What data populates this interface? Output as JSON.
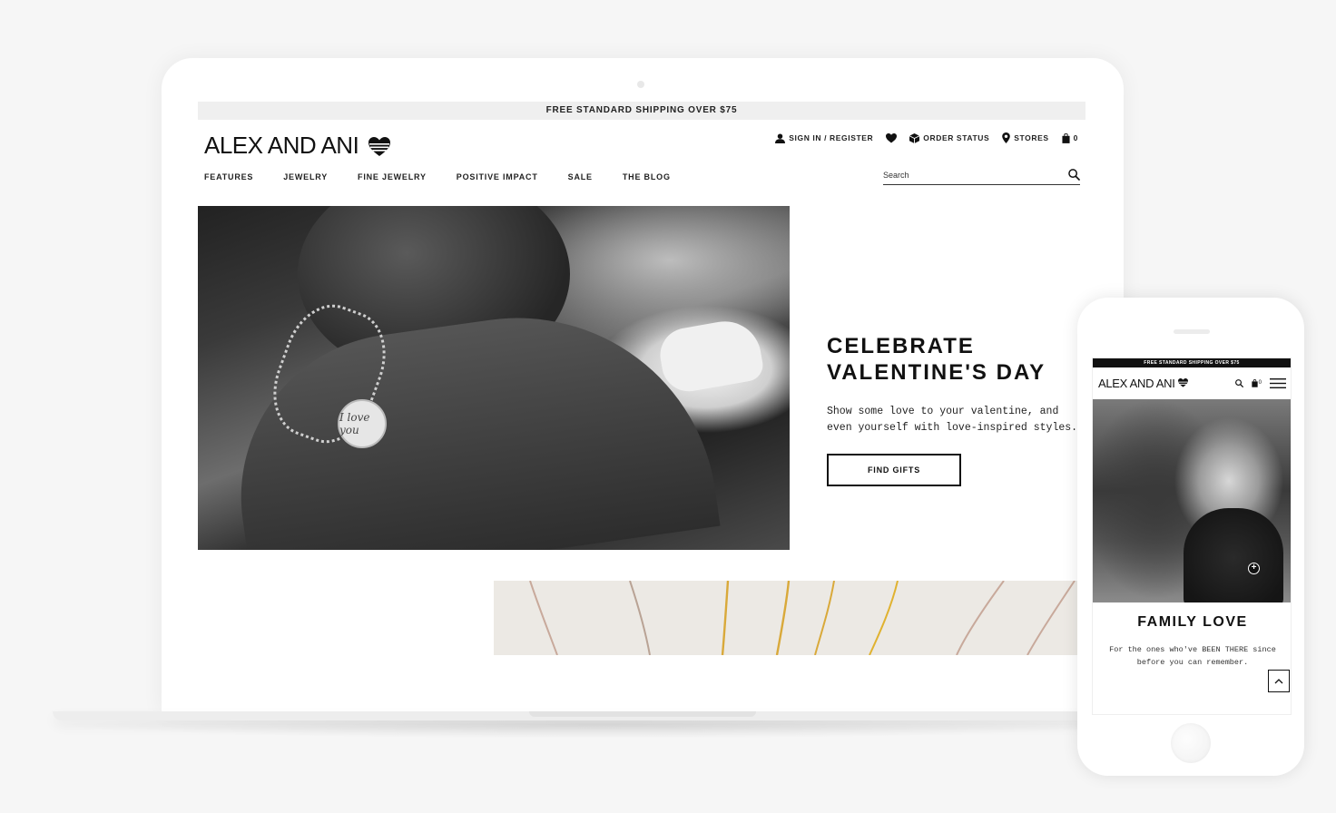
{
  "desktop": {
    "promo": "FREE STANDARD SHIPPING OVER $75",
    "logo": "ALEX AND ANI",
    "utility": {
      "sign_in": "SIGN IN / REGISTER",
      "order_status": "ORDER STATUS",
      "stores": "STORES",
      "cart_count": "0"
    },
    "nav": [
      "FEATURES",
      "JEWELRY",
      "FINE JEWELRY",
      "POSITIVE IMPACT",
      "SALE",
      "THE BLOG"
    ],
    "search": {
      "placeholder": "Search"
    },
    "hero": {
      "title": "CELEBRATE\nVALENTINE'S DAY",
      "text": "Show some love to your valentine, and even yourself with love-inspired styles.",
      "button": "FIND GIFTS",
      "charm_text": "I love you"
    }
  },
  "mobile": {
    "promo": "FREE STANDARD SHIPPING OVER $75",
    "logo": "ALEX AND ANI",
    "cart_count": "0",
    "hero": {
      "title": "FAMILY LOVE",
      "text": "For the ones who've BEEN THERE since before you can remember."
    }
  },
  "colors": {
    "background": "#f6f6f6",
    "promo_bar": "#efefef",
    "text": "#111111",
    "mobile_promo": "#111111",
    "gold_chain": "#d9a93a",
    "rose_chain": "#c8a99b"
  }
}
